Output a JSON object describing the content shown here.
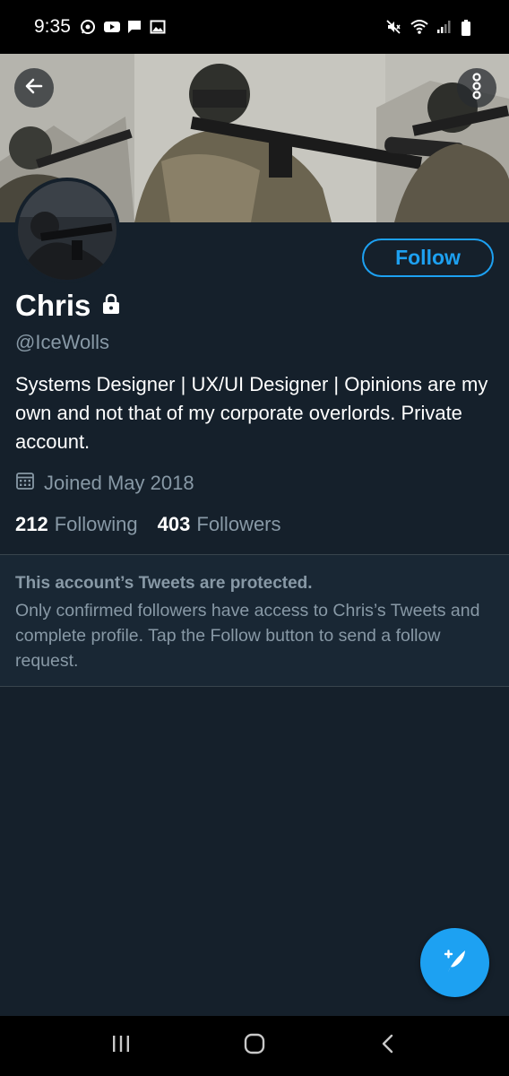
{
  "status_bar": {
    "time": "9:35",
    "left_icons": [
      "whatsapp-icon",
      "youtube-icon",
      "message-icon",
      "gallery-icon"
    ],
    "right_icons": [
      "mute-icon",
      "wifi-icon",
      "signal-icon",
      "battery-icon"
    ]
  },
  "header": {
    "back_icon": "arrow-back-icon",
    "more_icon": "more-vertical-icon"
  },
  "profile": {
    "name": "Chris",
    "handle": "@IceWolls",
    "bio": "Systems Designer | UX/UI Designer | Opinions are my own and not that of my corporate overlords. Private account.",
    "joined": "Joined May 2018",
    "following_count": "212",
    "following_label": "Following",
    "followers_count": "403",
    "followers_label": "Followers",
    "follow_button": "Follow"
  },
  "protected_notice": {
    "title": "This account’s Tweets are protected.",
    "text": "Only confirmed followers have access to Chris’s Tweets and complete profile. Tap the Follow button to send a follow request."
  },
  "fab": {
    "icon": "compose-tweet-icon"
  },
  "nav_bar": {
    "icons": [
      "recent-apps-icon",
      "home-icon",
      "back-icon"
    ]
  },
  "colors": {
    "background": "#15202b",
    "accent": "#1da1f2",
    "secondary_text": "#8899a6",
    "divider": "#38444d"
  }
}
